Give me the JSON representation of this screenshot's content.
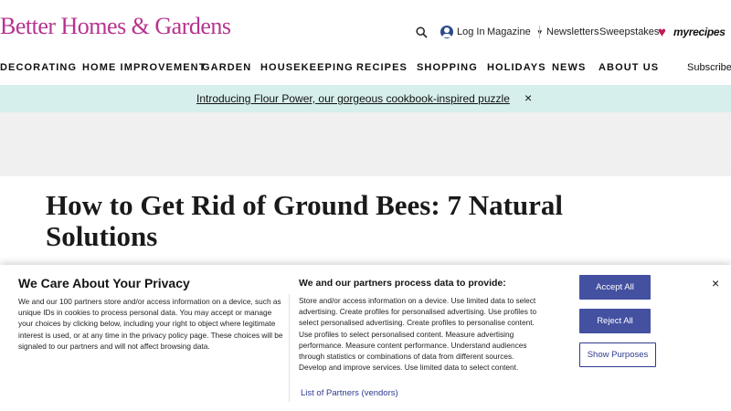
{
  "header": {
    "logo": "Better Homes & Gardens",
    "login": "Log In",
    "magazine": "Magazine",
    "newsletters": "Newsletters",
    "sweepstakes": "Sweepstakes",
    "partner_logo": "myrecipes"
  },
  "nav": {
    "items": [
      "DECORATING",
      "HOME IMPROVEMENT",
      "GARDEN",
      "HOUSEKEEPING",
      "RECIPES",
      "SHOPPING",
      "HOLIDAYS",
      "NEWS",
      "ABOUT US"
    ],
    "subscribe": "Subscribe"
  },
  "promo": {
    "text": "Introducing Flour Power, our gorgeous cookbook-inspired puzzle",
    "close": "×"
  },
  "article": {
    "title": "How to Get Rid of Ground Bees: 7 Natural Solutions"
  },
  "consent": {
    "title": "We Care About Your Privacy",
    "body": "We and our 100 partners store and/or access information on a device, such as unique IDs in cookies to process personal data. You may accept or manage your choices by clicking below, including your right to object where legitimate interest is used, or at any time in the privacy policy page. These choices will be signaled to our partners and will not affect browsing data.",
    "purposes_title": "We and our partners process data to provide:",
    "purposes_body": "Store and/or access information on a device. Use limited data to select advertising. Create profiles for personalised advertising. Use profiles to select personalised advertising. Create profiles to personalise content. Use profiles to select personalised content. Measure advertising performance. Measure content performance. Understand audiences through statistics or combinations of data from different sources. Develop and improve services. Use limited data to select content.",
    "partners_link": "List of Partners (vendors)",
    "accept_all": "Accept All",
    "reject_all": "Reject All",
    "show_purposes": "Show Purposes",
    "close": "×"
  },
  "colors": {
    "brand": "#b7338f",
    "promo_bg": "#d7efec",
    "button_primary": "#4450a0"
  },
  "icons": [
    "search-icon",
    "user-icon",
    "chevron-down-icon",
    "heart-icon",
    "close-icon"
  ]
}
